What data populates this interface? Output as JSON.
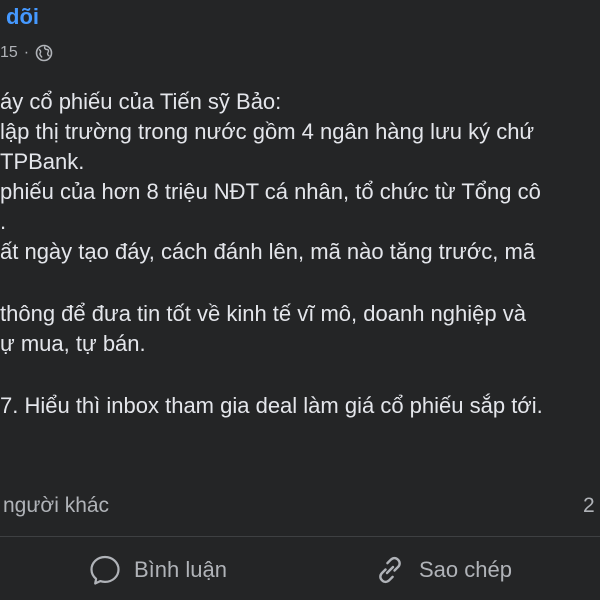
{
  "header": {
    "name_fragment": "dõi"
  },
  "meta": {
    "time_fragment": "15",
    "separator": "·",
    "privacy_icon": "globe-icon"
  },
  "post": {
    "lines": [
      "áy cổ phiếu của Tiến sỹ Bảo:",
      "lập thị trường trong nước gồm 4 ngân hàng lưu ký chứ",
      "TPBank.",
      "phiếu của hơn 8 triệu NĐT cá nhân, tổ chức từ Tổng cô",
      ".",
      "ất ngày tạo đáy, cách đánh lên, mã nào tăng trước, mã",
      "",
      "thông để đưa tin tốt về kinh tế vĩ mô, doanh nghiệp và",
      "ự mua, tự bán.",
      "",
      "7. Hiểu thì inbox tham gia deal làm giá cổ phiếu sắp tới."
    ]
  },
  "stats": {
    "reactions_text": "người khác",
    "comment_count": "2"
  },
  "actions": {
    "comment_label": "Bình luận",
    "comment_icon": "comment-bubble-icon",
    "copy_label": "Sao chép",
    "copy_icon": "link-icon"
  },
  "colors": {
    "background": "#242526",
    "text_primary": "#e4e6eb",
    "text_secondary": "#b0b3b8",
    "link_blue": "#4599ff",
    "divider": "#3e4042"
  }
}
